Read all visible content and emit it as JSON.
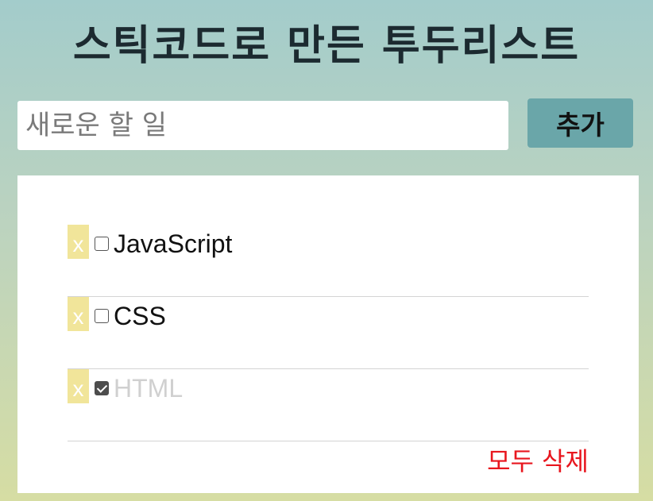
{
  "header": {
    "title": "스틱코드로 만든 투두리스트"
  },
  "input": {
    "placeholder": "새로운 할 일",
    "value": ""
  },
  "add_button": {
    "label": "추가"
  },
  "todos": [
    {
      "delete_label": "x",
      "text": "JavaScript",
      "checked": false
    },
    {
      "delete_label": "x",
      "text": "CSS",
      "checked": false
    },
    {
      "delete_label": "x",
      "text": "HTML",
      "checked": true
    }
  ],
  "footer": {
    "clear_all_label": "모두 삭제"
  },
  "colors": {
    "accent_button": "#6aa6a9",
    "delete_button": "#f1e59a",
    "clear_all": "#e8161e",
    "completed_text": "#d0d0d0"
  }
}
